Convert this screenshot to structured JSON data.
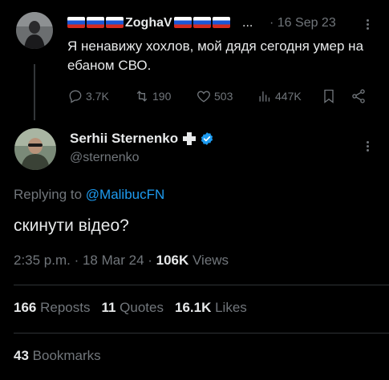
{
  "parent_tweet": {
    "display_name": "ZoghaV",
    "name_suffix": "...",
    "date": "· 16 Sep 23",
    "text": "Я ненавижу хохлов, мой дядя сегодня умер на ебаном СВО.",
    "replies": "3.7K",
    "reposts": "190",
    "likes": "503",
    "views": "447K"
  },
  "main_tweet": {
    "display_name": "Serhii Sternenko",
    "handle": "@sternenko",
    "replying_prefix": "Replying to ",
    "replying_to": "@MalibucFN",
    "text": "скинути відео?",
    "time": "2:35 p.m. · 18 Mar 24 · ",
    "views_count": "106K",
    "views_label": " Views",
    "reposts_count": "166",
    "reposts_label": " Reposts",
    "quotes_count": "11",
    "quotes_label": " Quotes",
    "likes_count": "16.1K",
    "likes_label": " Likes",
    "bookmarks_count": "43",
    "bookmarks_label": " Bookmarks"
  },
  "colors": {
    "background": "#000000",
    "text_primary": "#e7e9ea",
    "text_secondary": "#71767b",
    "accent": "#1d9bf0",
    "divider": "#2f3336"
  },
  "icons": [
    "reply-icon",
    "repost-icon",
    "like-icon",
    "views-icon",
    "bookmark-icon",
    "share-icon",
    "verified-badge-icon",
    "more-icon"
  ]
}
